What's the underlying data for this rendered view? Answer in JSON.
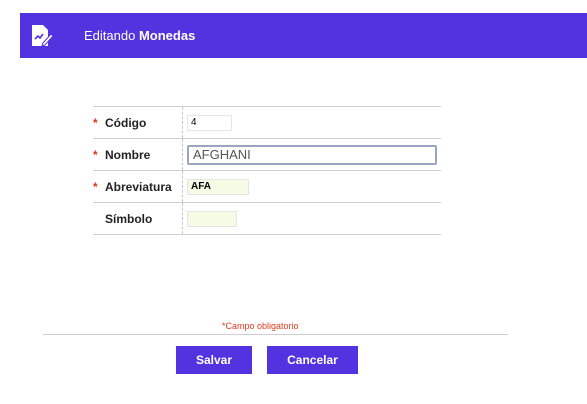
{
  "header": {
    "prefix": "Editando",
    "entity": "Monedas",
    "icon": "edit-document-icon",
    "color": "#5233e0"
  },
  "form": {
    "required_mark": "*",
    "fields": [
      {
        "label": "Código",
        "value": "4",
        "required": true
      },
      {
        "label": "Nombre",
        "value": "AFGHANI",
        "required": true
      },
      {
        "label": "Abreviatura",
        "value": "AFA",
        "required": true
      },
      {
        "label": "Símbolo",
        "value": "",
        "required": false
      }
    ]
  },
  "required_note": "*Campo obligatorio",
  "buttons": {
    "save_label": "Salvar",
    "cancel_label": "Cancelar"
  }
}
